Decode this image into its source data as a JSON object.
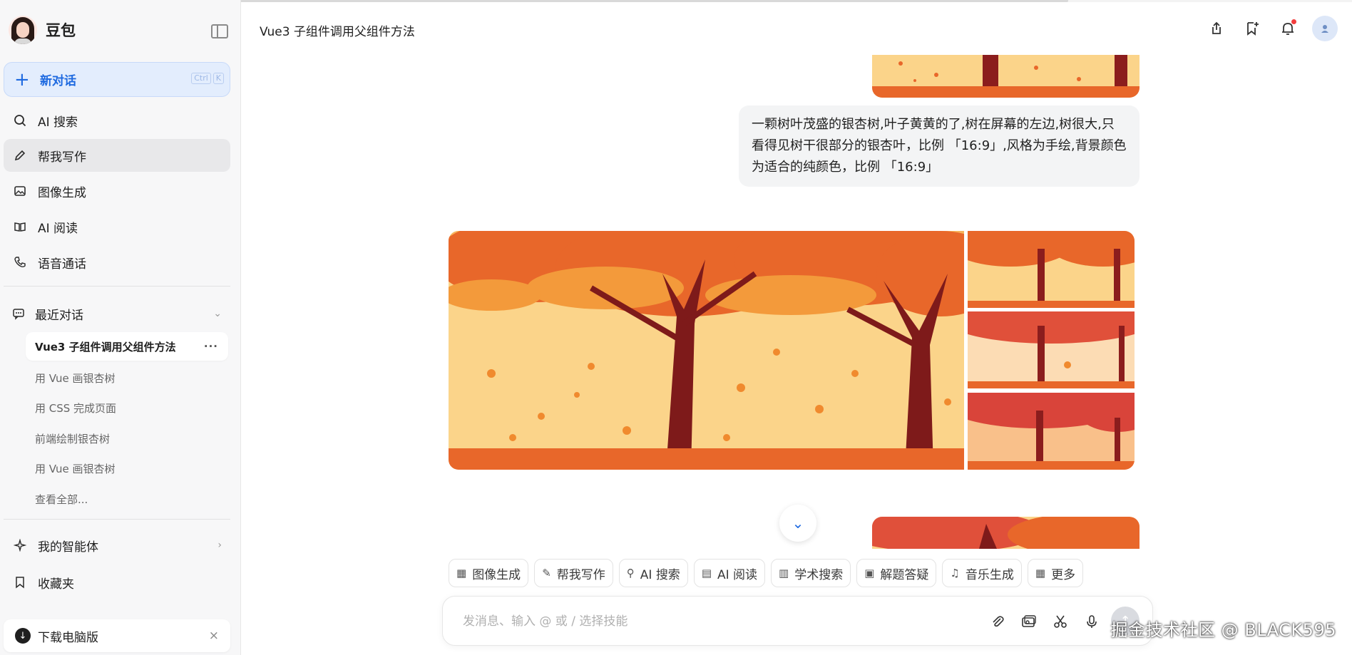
{
  "sidebar": {
    "brand_name": "豆包",
    "new_chat": {
      "label": "新对话",
      "shortcut": [
        "Ctrl",
        "K"
      ]
    },
    "nav": [
      {
        "label": "AI 搜索",
        "icon": "ai-search-icon"
      },
      {
        "label": "帮我写作",
        "icon": "pen-icon"
      },
      {
        "label": "图像生成",
        "icon": "image-icon"
      },
      {
        "label": "AI 阅读",
        "icon": "book-icon"
      },
      {
        "label": "语音通话",
        "icon": "phone-icon"
      }
    ],
    "recent_title": "最近对话",
    "history": [
      "Vue3 子组件调用父组件方法",
      "用 Vue 画银杏树",
      "用 CSS 完成页面",
      "前端绘制银杏树",
      "用 Vue 画银杏树",
      "查看全部..."
    ],
    "agents_label": "我的智能体",
    "favorites_label": "收藏夹",
    "download_label": "下载电脑版"
  },
  "header": {
    "title": "Vue3 子组件调用父组件方法"
  },
  "chat": {
    "user_message": "一颗树叶茂盛的银杏树,叶子黄黄的了,树在屏幕的左边,树很大,只看得见树干很部分的银杏叶，比例 「16:9」,风格为手绘,背景颜色为适合的纯颜色，比例 「16:9」"
  },
  "skills": [
    {
      "label": "图像生成",
      "icon": "image-icon"
    },
    {
      "label": "帮我写作",
      "icon": "pen-icon"
    },
    {
      "label": "AI 搜索",
      "icon": "ai-search-icon"
    },
    {
      "label": "AI 阅读",
      "icon": "book-icon"
    },
    {
      "label": "学术搜索",
      "icon": "chart-icon"
    },
    {
      "label": "解题答疑",
      "icon": "solve-icon"
    },
    {
      "label": "音乐生成",
      "icon": "music-icon"
    },
    {
      "label": "更多",
      "icon": "grid-icon"
    }
  ],
  "input": {
    "placeholder": "发消息、输入 @ 或 / 选择技能"
  },
  "watermark": "掘金技术社区 @ BLACK595",
  "colors": {
    "accent": "#1f6ae0",
    "sky": "#fbd48a",
    "trunk": "#8b1d1d",
    "foliage": "#e8672a"
  }
}
